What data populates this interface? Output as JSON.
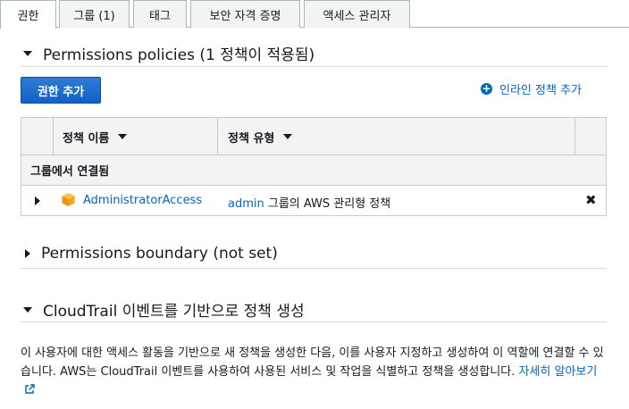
{
  "tabs": [
    {
      "label": "권한",
      "active": true
    },
    {
      "label": "그룹 (1)"
    },
    {
      "label": "태그"
    },
    {
      "label": "보안 자격 증명"
    },
    {
      "label": "액세스 관리자"
    }
  ],
  "permissions": {
    "title": "Permissions policies (1 정책이 적용됨)",
    "add_button": "권한 추가",
    "inline_add": "인라인 정책 추가",
    "table": {
      "columns": [
        "정책 이름",
        "정책 유형"
      ],
      "group_header": "그룹에서 연결됨",
      "rows": [
        {
          "name": "AdministratorAccess",
          "type_link": "admin",
          "type_rest": " 그룹의 AWS 관리형 정책"
        }
      ]
    }
  },
  "boundary": {
    "title": "Permissions boundary (not set)"
  },
  "cloudtrail": {
    "title": "CloudTrail 이벤트를 기반으로 정책 생성",
    "description": "이 사용자에 대한 액세스 활동을 기반으로 새 정책을 생성한 다음, 이를 사용자 지정하고 생성하여 이 역할에 연결할 수 있습니다. AWS는 CloudTrail 이벤트를 사용하여 사용된 서비스 및 작업을 식별하고 정책을 생성합니다.",
    "learn_more": "자세히 알아보기"
  },
  "colors": {
    "link": "#0066c0",
    "primary_button": "#1162c6",
    "policy_icon": "#f2a618"
  }
}
